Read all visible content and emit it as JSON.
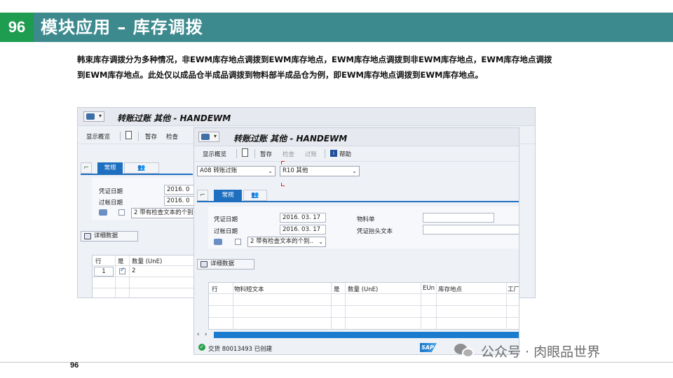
{
  "slide": {
    "number": "96",
    "title": "模块应用 – 库存调拨",
    "intro": "韩束库存调拨分为多种情况，非EWM库存地点调拨到EWM库存地点，EWM库存地点调拨到非EWM库存地点，EWM库存地点调拨到EWM库存地点。此处仅以成品仓半成品调拨到物料部半成品仓为例，即EWM库存地点调拨到EWM库存地点。",
    "footer_page": "96",
    "watermark": "公众号 · 肉眼品世界"
  },
  "back_window": {
    "title": "转账过账 其他 - HANDEWM",
    "toolbar": {
      "overview": "显示概览",
      "hold": "暂存",
      "check": "检查"
    },
    "tab_general": "常规",
    "doc_date_label": "凭证日期",
    "doc_date_value": "2016. 0",
    "post_date_label": "过帐日期",
    "post_date_value": "2016. 0",
    "print_option": "2 带有检查文本的个别",
    "detail_button": "详细数据",
    "grid_headers": {
      "row": "行",
      "ok": "是",
      "qty": "数量 (UnE)"
    },
    "grid_rows": [
      {
        "row": "1",
        "qty": "2"
      }
    ]
  },
  "front_window": {
    "title": "转账过账 其他 - HANDEWM",
    "toolbar": {
      "overview": "显示概览",
      "hold": "暂存",
      "check": "检查",
      "post": "过账",
      "help": "帮助"
    },
    "transaction": "A08 转账过账",
    "movement": "R10 其他",
    "tab_general": "常规",
    "doc_date_label": "凭证日期",
    "doc_date_value": "2016. 03. 17",
    "post_date_label": "过帐日期",
    "post_date_value": "2016. 03. 17",
    "material_slip_label": "物料单",
    "header_text_label": "凭证抬头文本",
    "print_option": "2 带有检查文本的个别..",
    "detail_button": "详细数据",
    "grid_headers": {
      "row": "行",
      "material_text": "物料短文本",
      "ok": "是",
      "qty": "数量 (UnE)",
      "eun": "EUn",
      "sloc": "库存地点",
      "plant": "工厂"
    },
    "status_text": "交货 80013493 已创建",
    "sap_logo": "SAP"
  },
  "colors": {
    "title_bar": "#3d8a8e",
    "number_box": "#1e9c50",
    "sap_blue": "#1f6fc0"
  }
}
